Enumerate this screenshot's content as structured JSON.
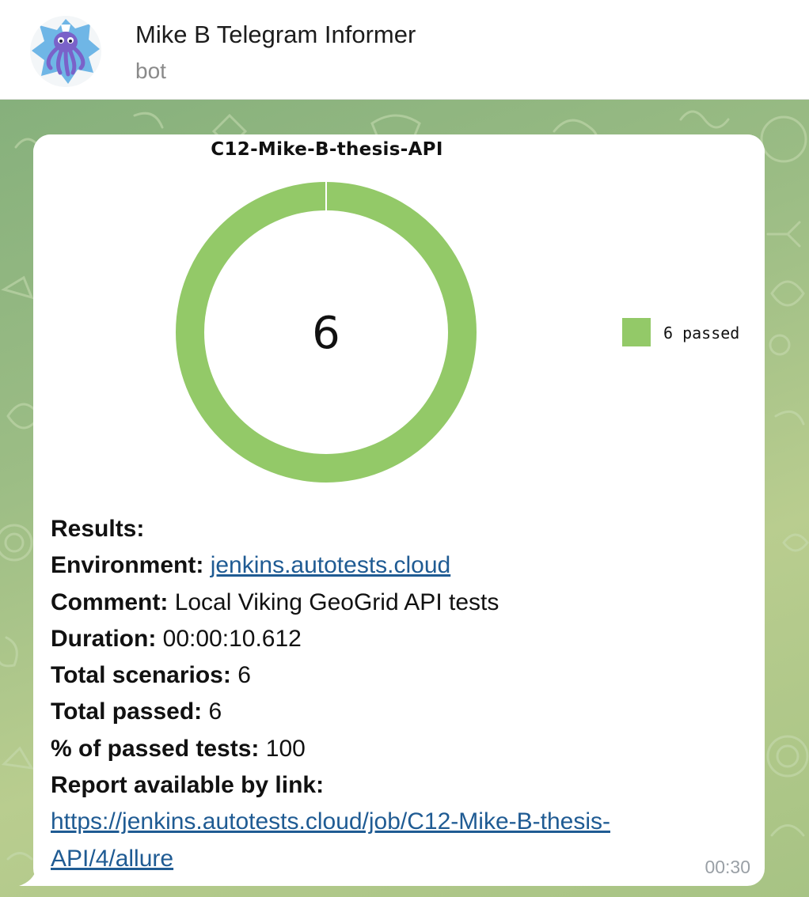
{
  "header": {
    "title": "Mike B Telegram Informer",
    "subtitle": "bot",
    "avatar_icon": "octopus-icon"
  },
  "message": {
    "chart_data": {
      "type": "pie",
      "title": "C12-Mike-B-thesis-API",
      "center_label": "6",
      "slices": [
        {
          "name": "6 passed",
          "value": 6,
          "color": "#93c968"
        }
      ],
      "legend": [
        "6 passed"
      ],
      "legend_position": "right"
    },
    "results": {
      "heading": "Results:",
      "environment_label": "Environment:",
      "environment_value": "jenkins.autotests.cloud",
      "comment_label": "Comment:",
      "comment_value": "Local Viking GeoGrid API tests",
      "duration_label": "Duration:",
      "duration_value": "00:00:10.612",
      "total_scenarios_label": "Total scenarios:",
      "total_scenarios_value": "6",
      "total_passed_label": "Total passed:",
      "total_passed_value": "6",
      "percent_label": "% of passed tests:",
      "percent_value": "100",
      "report_label": "Report available by link:",
      "report_link_line1": "https://jenkins.autotests.cloud/job/C12-Mike-B-thesis-",
      "report_link_line2": "API/4/allure"
    },
    "time": "00:30"
  },
  "colors": {
    "passed": "#93c968",
    "link": "#1f5b93",
    "chat_background": "#9cbd85"
  }
}
